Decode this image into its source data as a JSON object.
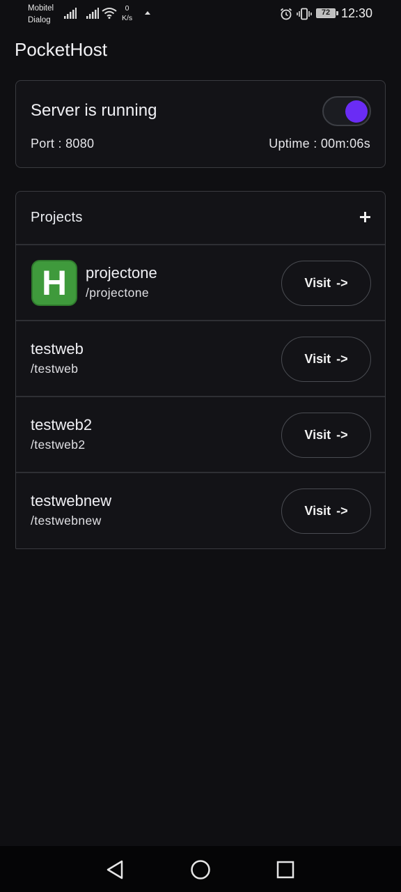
{
  "status_bar": {
    "carrier_1": "Mobitel",
    "carrier_2": "Dialog",
    "net_speed_value": "0",
    "net_speed_unit": "K/s",
    "battery_level": "72",
    "time": "12:30",
    "icons": [
      "signal-icon",
      "signal-icon",
      "wifi-icon",
      "upload-icon",
      "alarm-icon",
      "vibrate-icon",
      "battery-icon"
    ]
  },
  "app": {
    "title": "PocketHost"
  },
  "server": {
    "status_text": "Server is running",
    "toggle_on": true,
    "toggle_color": "#6a2cf5",
    "port_text": "Port : 8080",
    "uptime_text": "Uptime : 00m:06s"
  },
  "projects": {
    "title": "Projects",
    "add_icon": "plus-icon",
    "items": [
      {
        "name": "projectone",
        "path": "/projectone",
        "has_icon": true,
        "icon_letter": "H",
        "visit_label": "Visit",
        "visit_arrow": "->"
      },
      {
        "name": "testweb",
        "path": "/testweb",
        "has_icon": false,
        "visit_label": "Visit",
        "visit_arrow": "->"
      },
      {
        "name": "testweb2",
        "path": "/testweb2",
        "has_icon": false,
        "visit_label": "Visit",
        "visit_arrow": "->"
      },
      {
        "name": "testwebnew",
        "path": "/testwebnew",
        "has_icon": false,
        "visit_label": "Visit",
        "visit_arrow": "->"
      }
    ]
  },
  "navigation": {
    "buttons": [
      "back-icon",
      "home-icon",
      "recents-icon"
    ]
  }
}
